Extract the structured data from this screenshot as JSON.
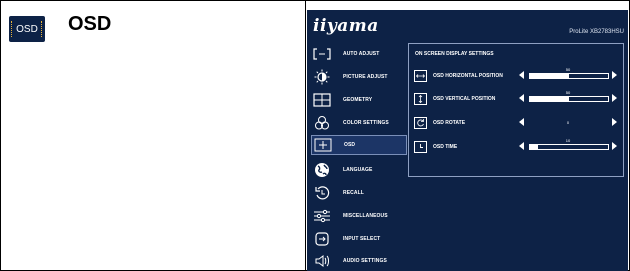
{
  "section": {
    "icon_label": "OSD",
    "title": "OSD"
  },
  "osd_screen": {
    "brand": "iiyama",
    "model": "ProLite XB2783HSU",
    "menu": [
      {
        "label": "AUTO ADJUST",
        "icon": "auto-adjust-icon",
        "active": false
      },
      {
        "label": "PICTURE ADJUST",
        "icon": "picture-adjust-icon",
        "active": false
      },
      {
        "label": "GEOMETRY",
        "icon": "geometry-icon",
        "active": false
      },
      {
        "label": "COLOR SETTINGS",
        "icon": "color-settings-icon",
        "active": false
      },
      {
        "label": "OSD",
        "icon": "osd-icon",
        "active": true
      },
      {
        "label": "LANGUAGE",
        "icon": "language-globe-icon",
        "active": false
      },
      {
        "label": "RECALL",
        "icon": "recall-icon",
        "active": false
      },
      {
        "label": "MISCELLANEOUS",
        "icon": "miscellaneous-sliders-icon",
        "active": false
      },
      {
        "label": "INPUT SELECT",
        "icon": "input-select-icon",
        "active": false
      },
      {
        "label": "AUDIO SETTINGS",
        "icon": "audio-speaker-icon",
        "active": false
      }
    ],
    "panel": {
      "title": "ON SCREEN DISPLAY SETTINGS",
      "rows": [
        {
          "label": "OSD HORIZONTAL POSITION",
          "icon": "horizontal-position-icon",
          "value": "50",
          "bar_fraction": 0.5
        },
        {
          "label": "OSD VERTICAL POSITION",
          "icon": "vertical-position-icon",
          "value": "50",
          "bar_fraction": 0.5
        },
        {
          "label": "OSD ROTATE",
          "icon": "rotate-icon",
          "value": "0"
        },
        {
          "label": "OSD TIME",
          "icon": "osd-time-icon",
          "value": "10",
          "bar_fraction": 0.1
        }
      ]
    }
  },
  "colors": {
    "osd_background": "#0d2246",
    "active_item": "#1c3566",
    "accent_dots": "#e8b23a"
  }
}
